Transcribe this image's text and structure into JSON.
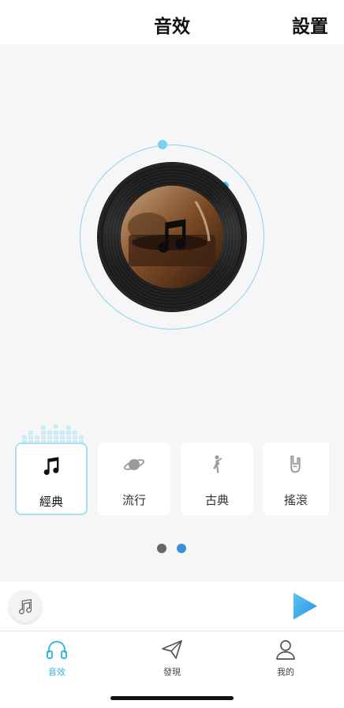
{
  "header": {
    "title": "音效",
    "settings_label": "設置"
  },
  "player_visual": {
    "center_icon": "music-note-icon",
    "accent_color": "#7ad1f2"
  },
  "effects": [
    {
      "label": "經典",
      "icon": "music-note-icon",
      "selected": true
    },
    {
      "label": "流行",
      "icon": "planet-icon",
      "selected": false
    },
    {
      "label": "古典",
      "icon": "dancer-icon",
      "selected": false
    },
    {
      "label": "搖滾",
      "icon": "rock-hand-icon",
      "selected": false
    }
  ],
  "pager": {
    "pages": 2,
    "active_page": 2
  },
  "mini_player": {
    "icon": "music-note-icon",
    "play_icon": "play-icon",
    "play_color": "#2aa6e8"
  },
  "tabs": [
    {
      "label": "音效",
      "icon": "headphones-icon",
      "active": true
    },
    {
      "label": "發現",
      "icon": "paper-plane-icon",
      "active": false
    },
    {
      "label": "我的",
      "icon": "user-icon",
      "active": false
    }
  ]
}
